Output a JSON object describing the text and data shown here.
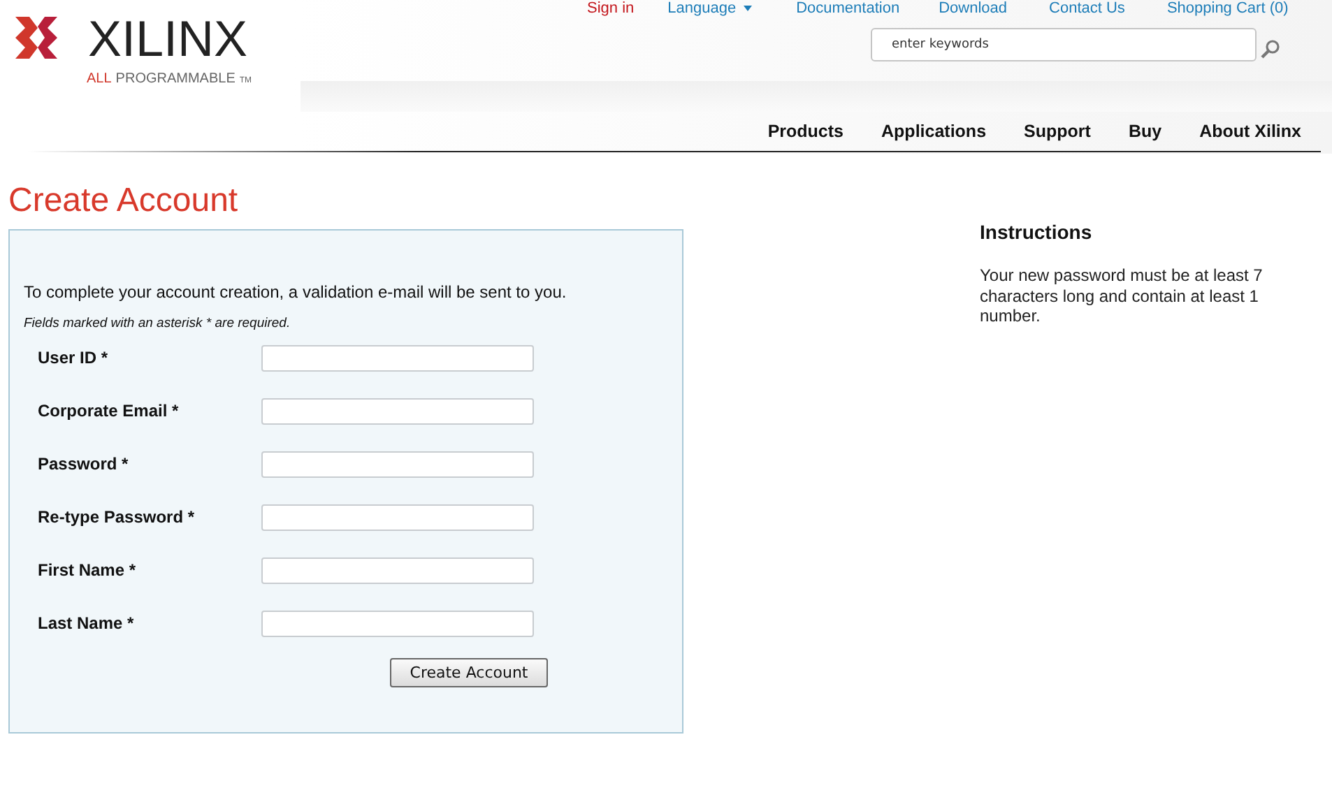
{
  "logo": {
    "wordmark": "XILINX",
    "tagline_lead": "ALL",
    "tagline": "PROGRAMMABLE",
    "trademark": "TM"
  },
  "top_links": [
    {
      "label": "Sign in",
      "kind": "signin"
    },
    {
      "label": "Language",
      "kind": "dropdown"
    },
    {
      "label": "Documentation",
      "kind": "link"
    },
    {
      "label": "Download",
      "kind": "link"
    },
    {
      "label": "Contact Us",
      "kind": "link"
    },
    {
      "label": "Shopping Cart  (0)",
      "kind": "link"
    }
  ],
  "search": {
    "placeholder": "enter keywords"
  },
  "nav": [
    "Products",
    "Applications",
    "Support",
    "Buy",
    "About Xilinx"
  ],
  "page_title": "Create Account",
  "form": {
    "intro": "To complete your account creation, a validation e-mail will be sent to you.",
    "note": "Fields marked with an asterisk * are required.",
    "fields": [
      {
        "label": "User ID *"
      },
      {
        "label": "Corporate Email *"
      },
      {
        "label": "Password *"
      },
      {
        "label": "Re-type Password *"
      },
      {
        "label": "First Name *"
      },
      {
        "label": "Last Name *"
      }
    ],
    "submit": "Create Account"
  },
  "instructions": {
    "title": "Instructions",
    "text": "Your new password must be at least 7 characters long and contain at least 1 number."
  }
}
